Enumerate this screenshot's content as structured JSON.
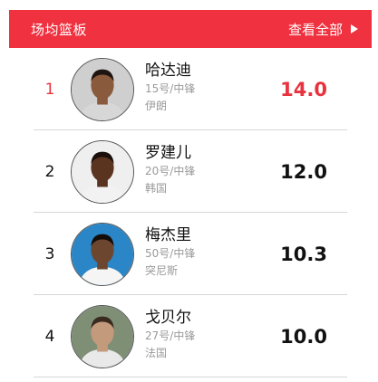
{
  "header": {
    "title": "场均篮板",
    "more_label": "查看全部",
    "color": "#f0313f"
  },
  "players": [
    {
      "rank": "1",
      "name": "哈达迪",
      "position": "15号/中锋",
      "country": "伊朗",
      "score": "14.0",
      "highlight": true,
      "skin": "#8a5a3c",
      "hair": "#1e1410",
      "jersey": "#d7d7d7",
      "bg": "#cfcfcf"
    },
    {
      "rank": "2",
      "name": "罗建儿",
      "position": "20号/中锋",
      "country": "韩国",
      "score": "12.0",
      "highlight": false,
      "skin": "#5b3420",
      "hair": "#1a0f0a",
      "jersey": "#f2f2f2",
      "bg": "#efefef"
    },
    {
      "rank": "3",
      "name": "梅杰里",
      "position": "50号/中锋",
      "country": "突尼斯",
      "score": "10.3",
      "highlight": false,
      "skin": "#6d4630",
      "hair": "#140c08",
      "jersey": "#f5f5f5",
      "bg": "#2b86c7"
    },
    {
      "rank": "4",
      "name": "戈贝尔",
      "position": "27号/中锋",
      "country": "法国",
      "score": "10.0",
      "highlight": false,
      "skin": "#c49a7c",
      "hair": "#3a2a20",
      "jersey": "#e9e9e9",
      "bg": "#7f8f76"
    }
  ],
  "accent_highlight": "#e8323d"
}
